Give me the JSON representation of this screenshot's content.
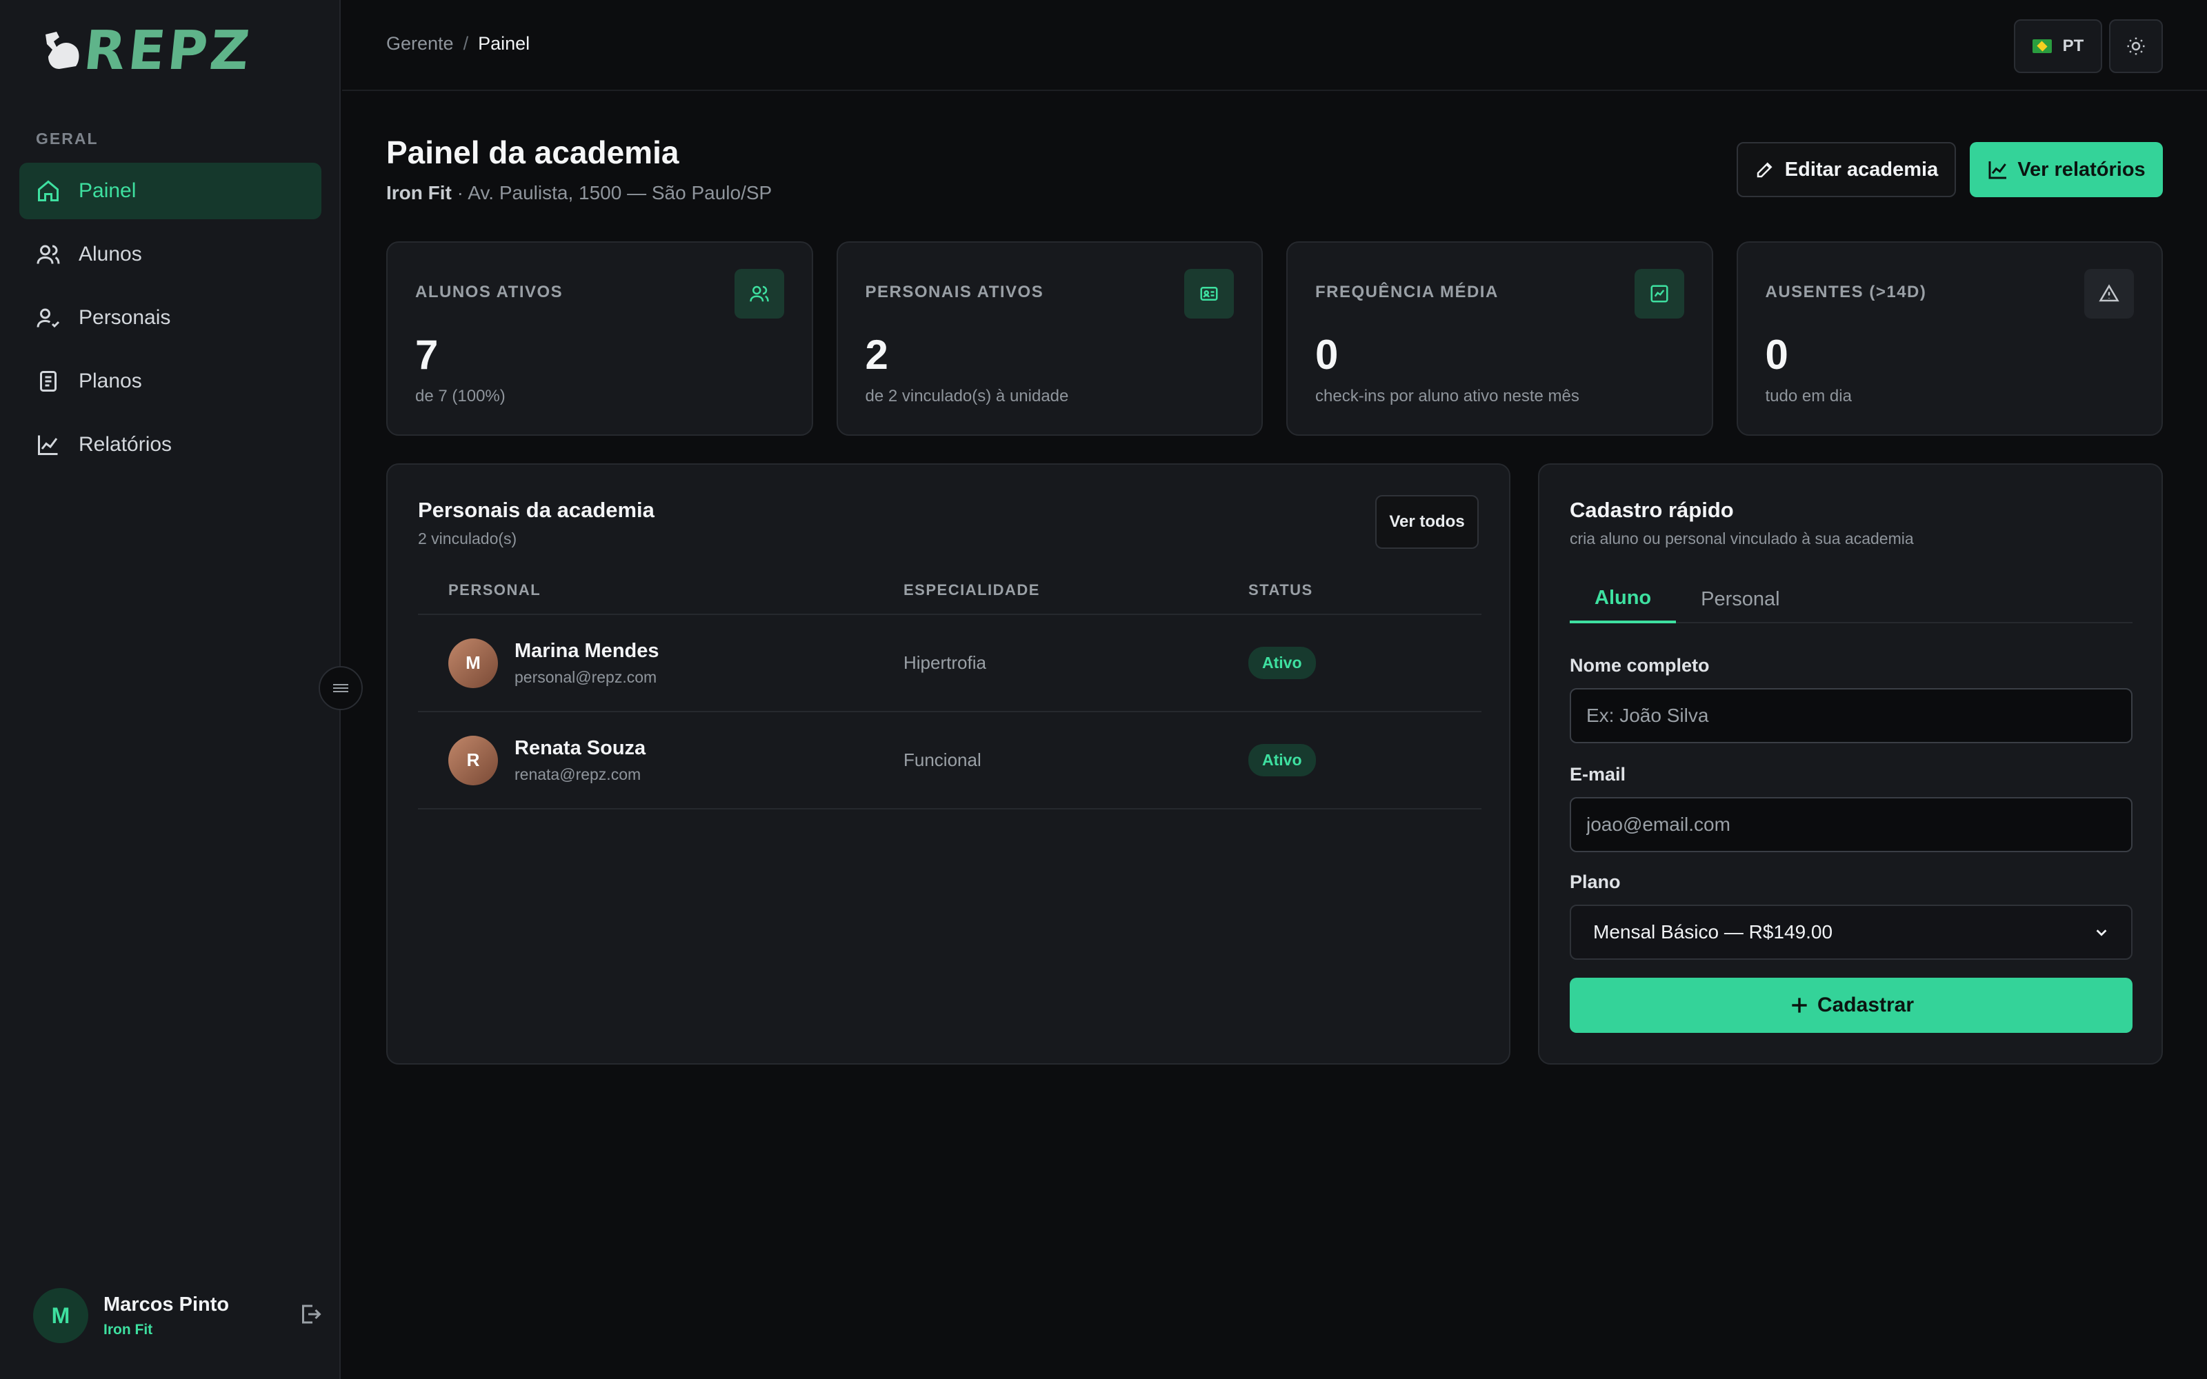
{
  "brand": {
    "name": "REPZ",
    "accent": "#34d399"
  },
  "sidebar": {
    "section": "GERAL",
    "items": [
      {
        "label": "Painel",
        "icon": "home-icon",
        "active": true
      },
      {
        "label": "Alunos",
        "icon": "users-icon"
      },
      {
        "label": "Personais",
        "icon": "user-check-icon"
      },
      {
        "label": "Planos",
        "icon": "document-icon"
      },
      {
        "label": "Relatórios",
        "icon": "chart-line-icon"
      }
    ],
    "user": {
      "initial": "M",
      "name": "Marcos Pinto",
      "gym": "Iron Fit"
    }
  },
  "topbar": {
    "breadcrumb": {
      "parent": "Gerente",
      "separator": "/",
      "current": "Painel"
    },
    "language": "PT"
  },
  "header": {
    "title": "Painel da academia",
    "gym_name": "Iron Fit",
    "address": " · Av. Paulista, 1500 — São Paulo/SP",
    "edit_label": "Editar academia",
    "reports_label": "Ver relatórios"
  },
  "stats": [
    {
      "label": "ALUNOS ATIVOS",
      "value": "7",
      "sub": "de 7 (100%)",
      "icon": "users-icon"
    },
    {
      "label": "PERSONAIS ATIVOS",
      "value": "2",
      "sub": "de 2 vinculado(s) à unidade",
      "icon": "id-card-icon"
    },
    {
      "label": "FREQUÊNCIA MÉDIA",
      "value": "0",
      "sub": "check-ins por aluno ativo neste mês",
      "icon": "trend-up-icon"
    },
    {
      "label": "AUSENTES (>14D)",
      "value": "0",
      "sub": "tudo em dia",
      "icon": "warning-icon"
    }
  ],
  "trainers": {
    "title": "Personais da academia",
    "subtitle": "2 vinculado(s)",
    "view_all": "Ver todos",
    "columns": [
      "PERSONAL",
      "ESPECIALIDADE",
      "STATUS"
    ],
    "rows": [
      {
        "initial": "M",
        "name": "Marina Mendes",
        "email": "personal@repz.com",
        "specialty": "Hipertrofia",
        "status": "Ativo"
      },
      {
        "initial": "R",
        "name": "Renata Souza",
        "email": "renata@repz.com",
        "specialty": "Funcional",
        "status": "Ativo"
      }
    ]
  },
  "quick_register": {
    "title": "Cadastro rápido",
    "subtitle": "cria aluno ou personal vinculado à sua academia",
    "tabs": [
      "Aluno",
      "Personal"
    ],
    "name_label": "Nome completo",
    "name_placeholder": "Ex: João Silva",
    "email_label": "E-mail",
    "email_placeholder": "joao@email.com",
    "plan_label": "Plano",
    "plan_selected": "Mensal Básico — R$149.00",
    "submit_label": "Cadastrar"
  }
}
